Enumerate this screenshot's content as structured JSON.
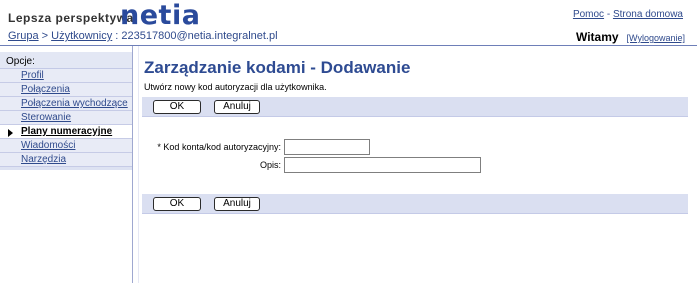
{
  "header": {
    "tagline": "Lepsza perspektywa",
    "logo": "netia",
    "breadcrumb": {
      "group": "Grupa",
      "sep1": " > ",
      "users": "Użytkownicy",
      "sep2": " : ",
      "account": "223517800@netia.integralnet.pl"
    },
    "links": {
      "help": "Pomoc",
      "sep": " - ",
      "home": "Strona domowa"
    },
    "welcome": "Witamy",
    "logout": "[Wylogowanie]"
  },
  "sidebar": {
    "heading": "Opcje:",
    "items": [
      {
        "label": "Profil",
        "active": false
      },
      {
        "label": "Połączenia przychodzące",
        "active": false
      },
      {
        "label": "Połączenia wychodzące",
        "active": false
      },
      {
        "label": "Sterowanie połączeniami",
        "active": false
      },
      {
        "label": "Plany numeracyjne",
        "active": true
      },
      {
        "label": "Wiadomości",
        "active": false
      },
      {
        "label": "Narzędzia",
        "active": false
      }
    ]
  },
  "main": {
    "title": "Zarządzanie kodami - Dodawanie",
    "subtitle": "Utwórz nowy kod autoryzacji dla użytkownika.",
    "ok_label": "OK",
    "cancel_label": "Anuluj",
    "fields": {
      "code_label": "* Kod konta/kod autoryzacyjny:",
      "code_value": "",
      "desc_label": "Opis:",
      "desc_value": ""
    }
  }
}
